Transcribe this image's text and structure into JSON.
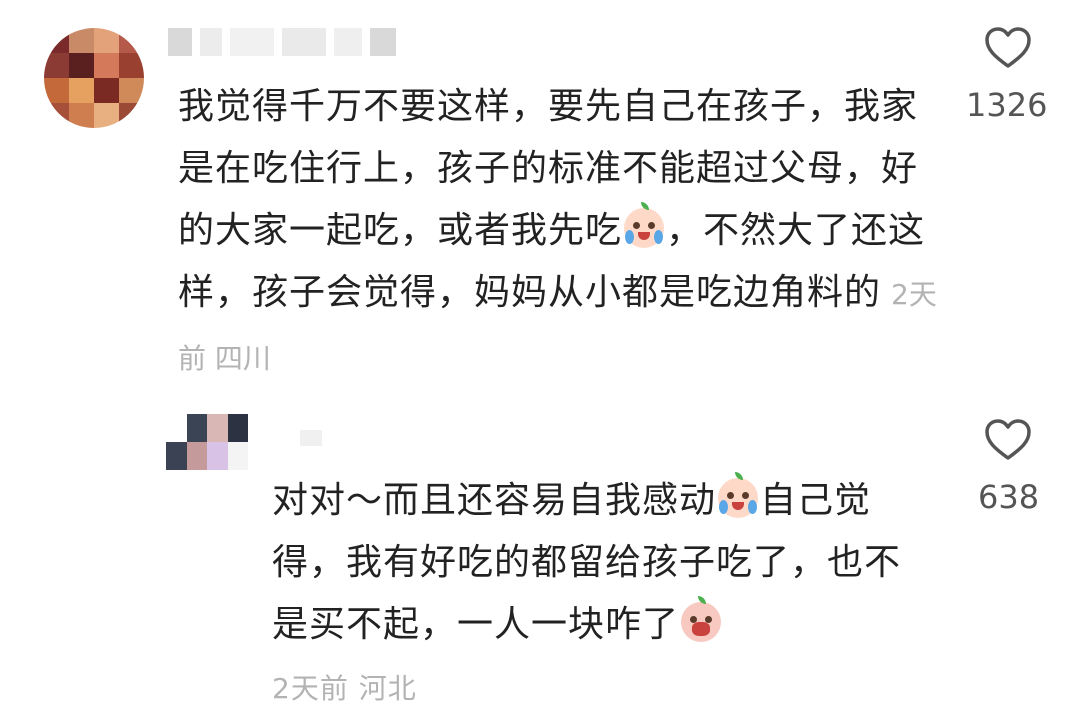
{
  "main_comment": {
    "text": "我觉得千万不要这样，要先自己在孩子，我家是在吃住行上，孩子的标准不能超过父母，好的大家一起吃，或者我先吃",
    "text_after_emoji": "，不然大了还这样，孩子会觉得，妈妈从小都是吃边角料的",
    "time": "2天前",
    "location": "四川",
    "likes": "1326"
  },
  "reply": {
    "text_part1": "对对～而且还容易自我感动",
    "text_part2": "自己觉得，我有好吃的都留给孩子吃了，也不是买不起，一人一块咋了",
    "time": "2天前",
    "location": "河北",
    "likes": "638"
  },
  "icons": {
    "like": "heart-outline-icon",
    "emoji_cry": "crying-face-emoji-icon",
    "emoji_shout": "shouting-face-emoji-icon"
  },
  "colors": {
    "text": "#222222",
    "meta": "#b3b3b3",
    "heart": "#555555"
  }
}
